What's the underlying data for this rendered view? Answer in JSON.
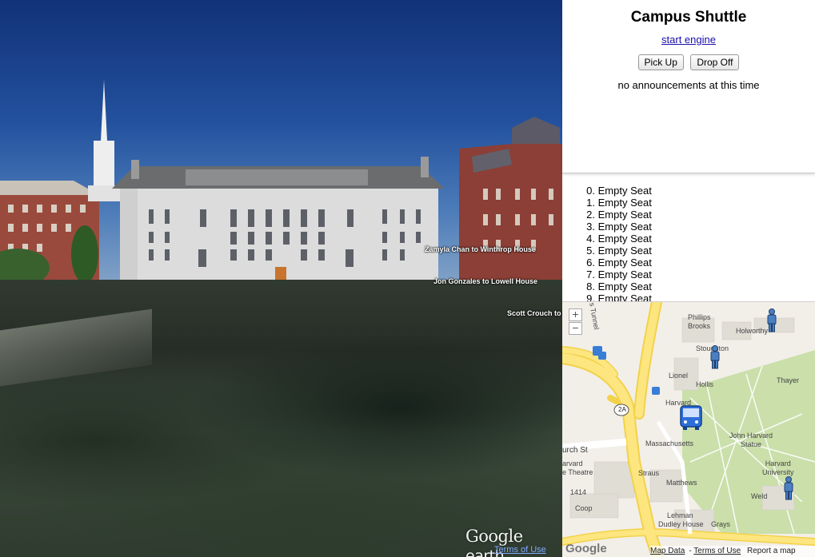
{
  "earth": {
    "labels": [
      "Zamyla Chan to Winthrop House",
      "Jon Gonzales to Lowell House",
      "Scott Crouch to L"
    ],
    "logo_google": "Google",
    "logo_earth": " earth",
    "terms": "Terms of Use"
  },
  "panel": {
    "title": "Campus Shuttle",
    "start_link": "start engine",
    "pickup_label": "Pick Up",
    "dropoff_label": "Drop Off",
    "announcement": "no announcements at this time"
  },
  "seats": [
    {
      "num": "0.",
      "label": "Empty Seat"
    },
    {
      "num": "1.",
      "label": "Empty Seat"
    },
    {
      "num": "2.",
      "label": "Empty Seat"
    },
    {
      "num": "3.",
      "label": "Empty Seat"
    },
    {
      "num": "4.",
      "label": "Empty Seat"
    },
    {
      "num": "5.",
      "label": "Empty Seat"
    },
    {
      "num": "6.",
      "label": "Empty Seat"
    },
    {
      "num": "7.",
      "label": "Empty Seat"
    },
    {
      "num": "8.",
      "label": "Empty Seat"
    },
    {
      "num": "9.",
      "label": "Empty Seat"
    }
  ],
  "map": {
    "zoom_in": "+",
    "zoom_out": "−",
    "labels": {
      "phillips_brooks": "Phillips\nBrooks",
      "holworthy": "Holworthy",
      "stoughton": "Stoughton",
      "lionel": "Lionel",
      "hollis": "Hollis",
      "thayer": "Thayer",
      "harvard": "Harvard",
      "massachusetts": "Massachusetts",
      "john_harvard_statue": "John Harvard\nStatue",
      "harvard_university": "Harvard\nUniversity",
      "church_st": "urch St",
      "harvard_theatre": "arvard\ne Theatre",
      "straus": "Straus",
      "matthews": "Matthews",
      "weld": "Weld",
      "n1414": "1414",
      "coop": "Coop",
      "lehman": "Lehman",
      "dudley_house": "Dudley House",
      "grays": "Grays",
      "tunnel": "s Tunnel",
      "route_2a": "2A"
    },
    "google": "Google",
    "map_data": "Map Data",
    "terms": "Terms of Use",
    "report": "Report a map error",
    "colors": {
      "road": "#fde680",
      "grass": "#cadfaa",
      "building": "#e0ddd5"
    }
  }
}
